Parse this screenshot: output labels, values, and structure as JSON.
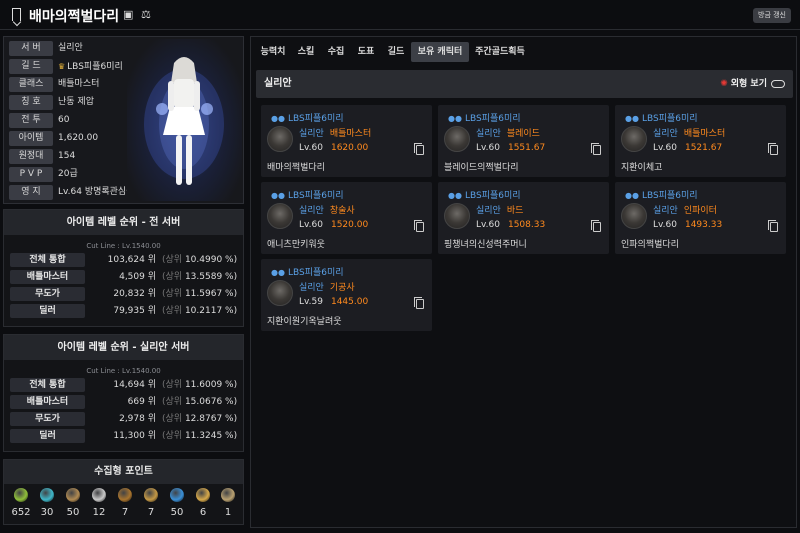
{
  "header": {
    "title": "배마의쩍벌다리",
    "refresh_label": "방금 갱신"
  },
  "profile": {
    "rows": [
      {
        "label": "서 버",
        "value": "실리안"
      },
      {
        "label": "길 드",
        "value": "LBS피플6미리",
        "crown": true
      },
      {
        "label": "클래스",
        "value": "배틀마스터"
      },
      {
        "label": "칭 호",
        "value": "난동 제압"
      },
      {
        "label": "전 투",
        "value": "60"
      },
      {
        "label": "아이템",
        "value": "1,620.00"
      },
      {
        "label": "원정대",
        "value": "154"
      },
      {
        "label": "P V P",
        "value": "20급"
      },
      {
        "label": "영 지",
        "value": "Lv.64 방명록관심금지"
      }
    ]
  },
  "rankings": [
    {
      "title": "아이템 레벨 순위 - 전 서버",
      "cutline": "Cut Line : Lv.1540.00",
      "rows": [
        {
          "label": "전체 통합",
          "rank": "103,624 위",
          "prefix": "(상위",
          "pct": "10.4990 %)"
        },
        {
          "label": "배틀마스터",
          "rank": "4,509 위",
          "prefix": "(상위",
          "pct": "13.5589 %)"
        },
        {
          "label": "무도가",
          "rank": "20,832 위",
          "prefix": "(상위",
          "pct": "11.5967 %)"
        },
        {
          "label": "딜러",
          "rank": "79,935 위",
          "prefix": "(상위",
          "pct": "10.2117 %)"
        }
      ]
    },
    {
      "title": "아이템 레벨 순위 - 실리안 서버",
      "cutline": "Cut Line : Lv.1540.00",
      "rows": [
        {
          "label": "전체 통합",
          "rank": "14,694 위",
          "prefix": "(상위",
          "pct": "11.6009 %)"
        },
        {
          "label": "배틀마스터",
          "rank": "669 위",
          "prefix": "(상위",
          "pct": "15.0676 %)"
        },
        {
          "label": "무도가",
          "rank": "2,978 위",
          "prefix": "(상위",
          "pct": "12.8767 %)"
        },
        {
          "label": "딜러",
          "rank": "11,300 위",
          "prefix": "(상위",
          "pct": "11.3245 %)"
        }
      ]
    }
  ],
  "collection": {
    "title": "수집형 포인트",
    "items": [
      {
        "icon": "mokoko-seed-icon",
        "count": "652",
        "color": "#8fbf3a"
      },
      {
        "icon": "island-heart-icon",
        "count": "30",
        "color": "#3fb7c9"
      },
      {
        "icon": "great-art-icon",
        "count": "50",
        "color": "#b08a52"
      },
      {
        "icon": "giant-heart-icon",
        "count": "12",
        "color": "#c9c9c9"
      },
      {
        "icon": "ignea-token-icon",
        "count": "7",
        "color": "#a8742e"
      },
      {
        "icon": "adventure-book-icon",
        "count": "7",
        "color": "#c49845"
      },
      {
        "icon": "voyage-leaf-icon",
        "count": "50",
        "color": "#3a8fd6"
      },
      {
        "icon": "omnium-star-icon",
        "count": "6",
        "color": "#d6a84a"
      },
      {
        "icon": "world-tree-icon",
        "count": "1",
        "color": "#b8a070"
      }
    ]
  },
  "tabs": [
    "능력치",
    "스킬",
    "수집",
    "도표",
    "길드",
    "보유 캐릭터",
    "주간골드획득"
  ],
  "active_tab": "보유 캐릭터",
  "server_section": {
    "name": "실리안",
    "view_label": "외형 보기"
  },
  "characters": [
    {
      "guild": "LBS피플6미리",
      "server": "실리안",
      "class": "배틀마스터",
      "level": "Lv.60",
      "ilvl": "1620.00",
      "name": "배마의쩍벌다리"
    },
    {
      "guild": "LBS피플6미리",
      "server": "실리안",
      "class": "블레이드",
      "level": "Lv.60",
      "ilvl": "1551.67",
      "name": "블레이드의쩍벌다리"
    },
    {
      "guild": "LBS피플6미리",
      "server": "실리안",
      "class": "배틀마스터",
      "level": "Lv.60",
      "ilvl": "1521.67",
      "name": "지환이체고"
    },
    {
      "guild": "LBS피플6미리",
      "server": "실리안",
      "class": "창술사",
      "level": "Lv.60",
      "ilvl": "1520.00",
      "name": "애니츠만키워웃"
    },
    {
      "guild": "LBS피플6미리",
      "server": "실리안",
      "class": "바드",
      "level": "Lv.60",
      "ilvl": "1508.33",
      "name": "핑챙녀의신성력주머니"
    },
    {
      "guild": "LBS피플6미리",
      "server": "실리안",
      "class": "인파이터",
      "level": "Lv.60",
      "ilvl": "1493.33",
      "name": "인파의쩍벌다리"
    },
    {
      "guild": "LBS피플6미리",
      "server": "실리안",
      "class": "기공사",
      "level": "Lv.59",
      "ilvl": "1445.00",
      "name": "지환이원기옥날려웃"
    }
  ]
}
